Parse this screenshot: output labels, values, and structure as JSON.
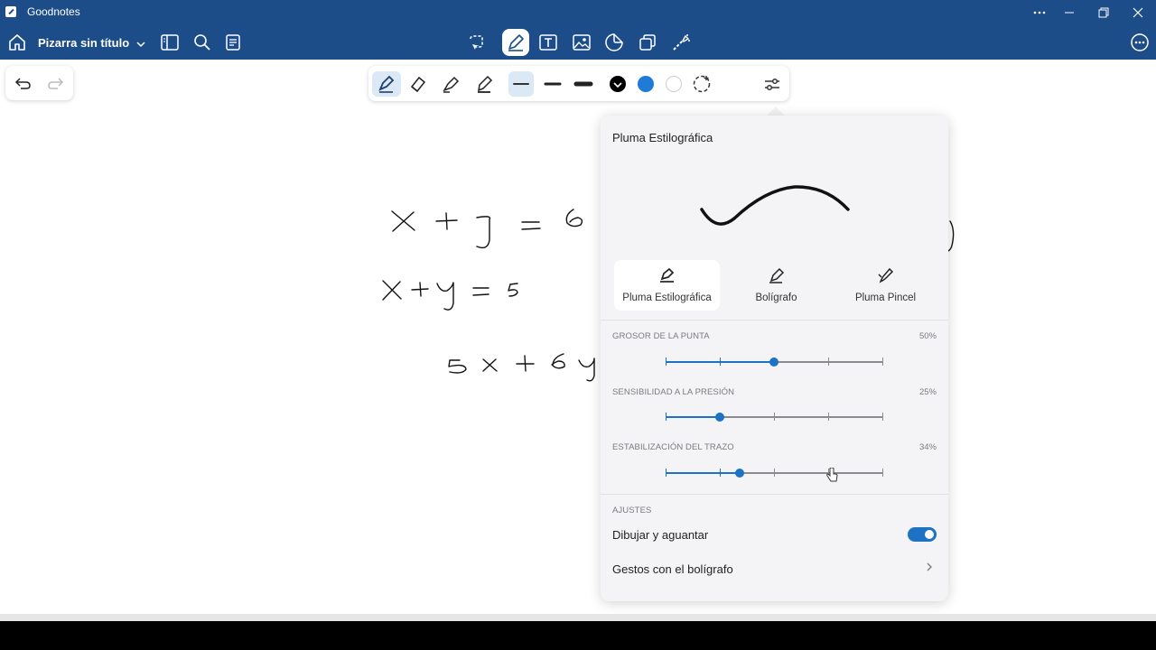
{
  "window": {
    "app_title": "Goodnotes"
  },
  "header": {
    "doc_title": "Pizarra sin título"
  },
  "panel": {
    "title": "Pluma Estilográfica",
    "pen_types": [
      {
        "label": "Pluma Estilográfica",
        "icon": "fountain-pen-icon",
        "selected": true
      },
      {
        "label": "Bolígrafo",
        "icon": "ballpoint-pen-icon",
        "selected": false
      },
      {
        "label": "Pluma Pincel",
        "icon": "brush-pen-icon",
        "selected": false
      }
    ],
    "sliders": [
      {
        "label": "GROSOR DE LA PUNTA",
        "value_text": "50%",
        "value": 0.5
      },
      {
        "label": "SENSIBILIDAD A LA PRESIÓN",
        "value_text": "25%",
        "value": 0.25
      },
      {
        "label": "ESTABILIZACIÓN DEL TRAZO",
        "value_text": "34%",
        "value": 0.34
      }
    ],
    "settings_label": "AJUSTES",
    "draw_hold_label": "Dibujar y aguantar",
    "draw_hold_enabled": true,
    "pen_gestures_label": "Gestos con el bolígrafo"
  },
  "colors": {
    "accent": "#1d72c4",
    "titlebar": "#1c4d88",
    "swatch_black": "#000000",
    "swatch_blue": "#1f7ad8",
    "swatch_white": "#ffffff"
  }
}
